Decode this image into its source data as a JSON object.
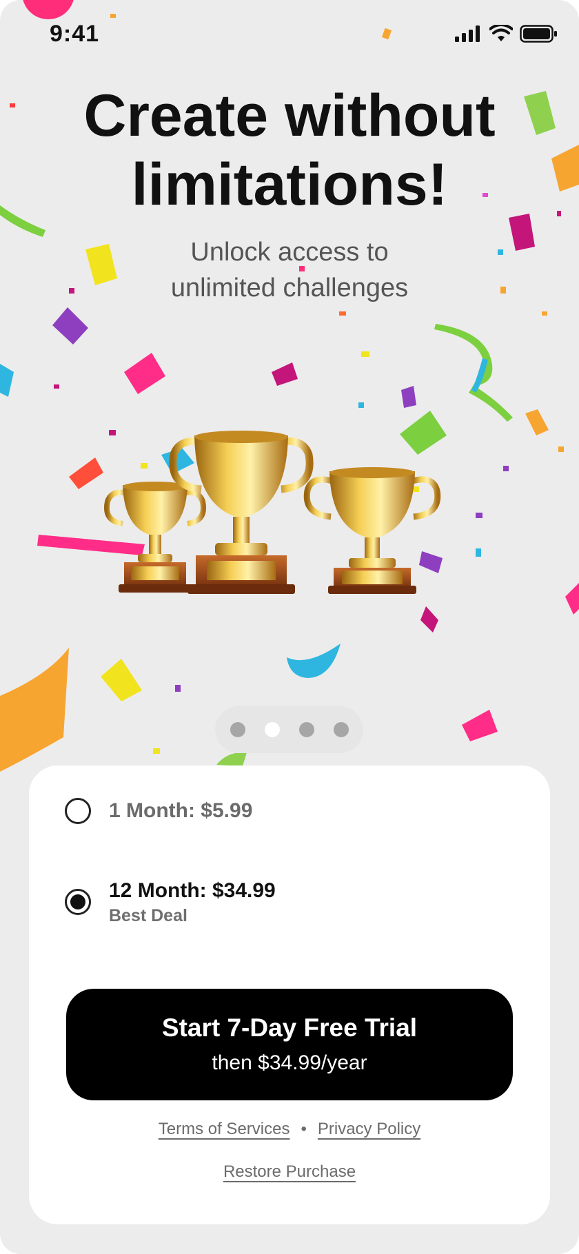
{
  "status_bar": {
    "time": "9:41"
  },
  "hero": {
    "title_line1": "Create without",
    "title_line2": "limitations!",
    "subtitle_line1": "Unlock access to",
    "subtitle_line2": "unlimited challenges"
  },
  "carousel": {
    "total_pages": 4,
    "active_page": 2
  },
  "plans": [
    {
      "title": "1 Month: $5.99",
      "badge": "",
      "selected": false
    },
    {
      "title": "12 Month: $34.99",
      "badge": "Best Deal",
      "selected": true
    }
  ],
  "cta": {
    "title": "Start 7-Day Free Trial",
    "subtitle": "then $34.99/year"
  },
  "footer": {
    "terms_label": "Terms of Services",
    "separator": "•",
    "privacy_label": "Privacy Policy",
    "restore_label": "Restore Purchase"
  },
  "colors": {
    "background": "#ececec",
    "card": "#ffffff",
    "cta_background": "#000000",
    "trophy_gold": "#d9a520"
  },
  "icons": [
    "signal-icon",
    "wifi-icon",
    "battery-icon",
    "trophy-icon",
    "radio-unselected-icon",
    "radio-selected-icon"
  ]
}
